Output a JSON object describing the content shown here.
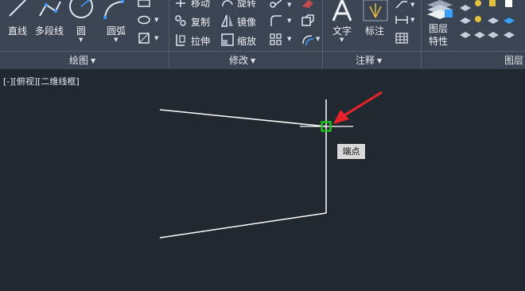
{
  "draw_panel": {
    "title": "绘图",
    "line_label": "直线",
    "polyline_label": "多段线",
    "circle_label": "圆",
    "arc_label": "圆弧"
  },
  "modify_panel": {
    "title": "修改",
    "move_label": "移动",
    "rotate_label": "旋转",
    "copy_label": "复制",
    "mirror_label": "镜像",
    "stretch_label": "拉伸",
    "scale_label": "缩放"
  },
  "annotation_panel": {
    "title": "注释",
    "text_label": "文字",
    "dimension_label": "标注"
  },
  "layers_panel": {
    "title": "图层",
    "layer_properties_label": "图层\n特性",
    "layer_properties_line1": "图层",
    "layer_properties_line2": "特性"
  },
  "viewport": {
    "label": "[-][俯视][二维线框]",
    "tooltip": "端点"
  },
  "colors": {
    "ribbon_bg": "#3b4453",
    "canvas_bg": "#212830",
    "drawing_line": "#ffffff",
    "snap_marker": "#1fbf1f",
    "arrow": "#e8232a"
  }
}
